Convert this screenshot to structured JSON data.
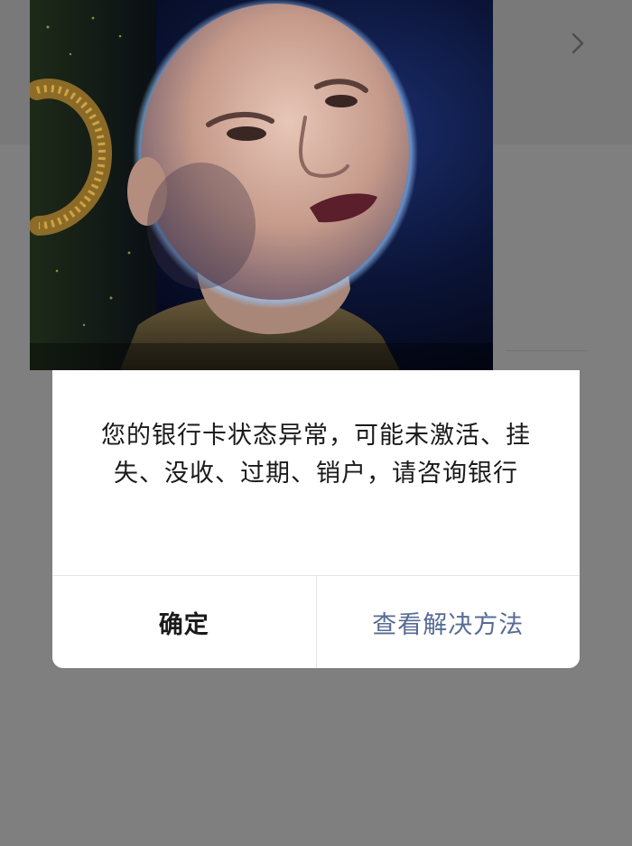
{
  "dialog": {
    "message": "您的银行卡状态异常，可能未激活、挂失、没收、过期、销户，请咨询银行",
    "confirm_label": "确定",
    "solution_label": "查看解决方法"
  },
  "meme": {
    "description_icon": "bald-monk-portrait"
  },
  "colors": {
    "link": "#576b95",
    "text": "#1a1a1a",
    "scrim": "#7f7f7f"
  },
  "icons": {
    "chevron": "chevron-right-icon"
  }
}
